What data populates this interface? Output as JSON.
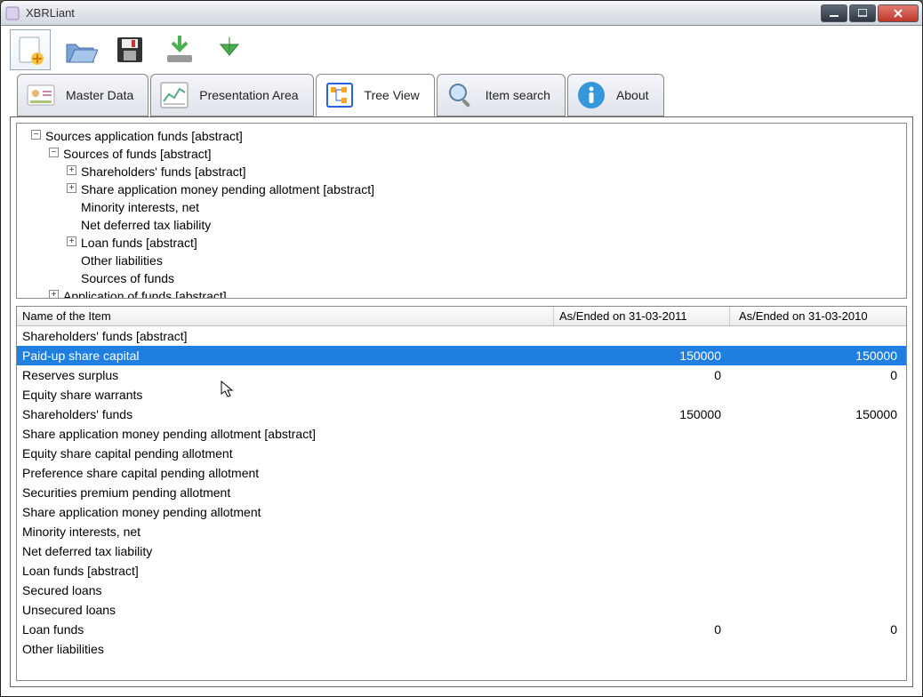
{
  "window": {
    "title": "XBRLiant"
  },
  "tabs": [
    {
      "label": "Master Data"
    },
    {
      "label": "Presentation Area"
    },
    {
      "label": "Tree View"
    },
    {
      "label": "Item search"
    },
    {
      "label": "About"
    }
  ],
  "tree": {
    "n1": "Sources application funds [abstract]",
    "n2": "Sources of funds [abstract]",
    "n3": "Shareholders' funds [abstract]",
    "n4": "Share application money pending allotment [abstract]",
    "n5": "Minority interests, net",
    "n6": "Net deferred tax liability",
    "n7": "Loan funds [abstract]",
    "n8": "Other liabilities",
    "n9": "Sources of funds",
    "n10": "Application of funds [abstract]"
  },
  "table": {
    "headers": {
      "name": "Name of the Item",
      "c1": "As/Ended on 31-03-2011",
      "c2": "As/Ended on 31-03-2010"
    },
    "rows": [
      {
        "name": "Shareholders' funds [abstract]",
        "v1": "",
        "v2": "",
        "indent": 0,
        "selected": false
      },
      {
        "name": "Paid-up share capital",
        "v1": "150000",
        "v2": "150000",
        "indent": 1,
        "selected": true
      },
      {
        "name": "Reserves surplus",
        "v1": "0",
        "v2": "0",
        "indent": 1,
        "selected": false
      },
      {
        "name": "Equity share warrants",
        "v1": "",
        "v2": "",
        "indent": 1,
        "selected": false
      },
      {
        "name": "Shareholders' funds",
        "v1": "150000",
        "v2": "150000",
        "indent": 1,
        "selected": false
      },
      {
        "name": "Share application money pending allotment [abstract]",
        "v1": "",
        "v2": "",
        "indent": 0,
        "selected": false
      },
      {
        "name": "Equity share capital pending allotment",
        "v1": "",
        "v2": "",
        "indent": 1,
        "selected": false
      },
      {
        "name": "Preference share capital pending allotment",
        "v1": "",
        "v2": "",
        "indent": 1,
        "selected": false
      },
      {
        "name": "Securities premium pending allotment",
        "v1": "",
        "v2": "",
        "indent": 1,
        "selected": false
      },
      {
        "name": "Share application money pending allotment",
        "v1": "",
        "v2": "",
        "indent": 1,
        "selected": false
      },
      {
        "name": "Minority interests, net",
        "v1": "",
        "v2": "",
        "indent": 0,
        "selected": false
      },
      {
        "name": "Net deferred tax liability",
        "v1": "",
        "v2": "",
        "indent": 0,
        "selected": false
      },
      {
        "name": "Loan funds [abstract]",
        "v1": "",
        "v2": "",
        "indent": 0,
        "selected": false
      },
      {
        "name": "Secured loans",
        "v1": "",
        "v2": "",
        "indent": 1,
        "selected": false
      },
      {
        "name": "Unsecured loans",
        "v1": "",
        "v2": "",
        "indent": 1,
        "selected": false
      },
      {
        "name": "Loan funds",
        "v1": "0",
        "v2": "0",
        "indent": 1,
        "selected": false
      },
      {
        "name": "Other liabilities",
        "v1": "",
        "v2": "",
        "indent": 0,
        "selected": false
      }
    ]
  }
}
